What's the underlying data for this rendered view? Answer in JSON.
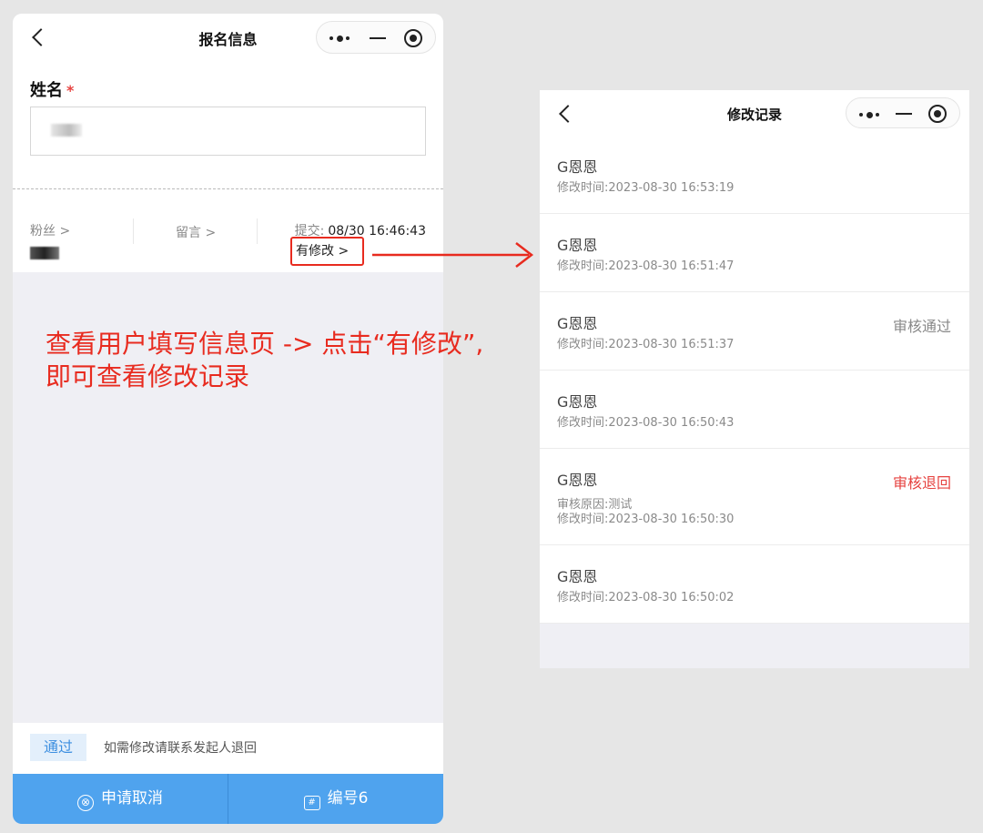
{
  "left": {
    "nav": {
      "title": "报名信息"
    },
    "form": {
      "name_label": "姓名",
      "required_mark": "*"
    },
    "stats": {
      "fans_label": "粉丝 >",
      "message_label": "留言 >",
      "submit_label": "提交:",
      "submit_time": "08/30 16:46:43",
      "modified_label": "有修改 >"
    },
    "bottom": {
      "badge": "通过",
      "hint": "如需修改请联系发起人退回"
    },
    "actions": {
      "cancel_icon": "⊗",
      "cancel_label": "申请取消",
      "number_icon": "#",
      "number_label": "编号6"
    }
  },
  "annotation": {
    "line1": "查看用户填写信息页 -> 点击“有修改”,",
    "line2": "即可查看修改记录",
    "color": "#e82b1f"
  },
  "right": {
    "nav": {
      "title": "修改记录"
    },
    "records": [
      {
        "name": "G恩恩",
        "time": "修改时间:2023-08-30 16:53:19",
        "status": "",
        "reason": ""
      },
      {
        "name": "G恩恩",
        "time": "修改时间:2023-08-30 16:51:47",
        "status": "",
        "reason": ""
      },
      {
        "name": "G恩恩",
        "time": "修改时间:2023-08-30 16:51:37",
        "status": "审核通过",
        "status_color": "#888888",
        "reason": ""
      },
      {
        "name": "G恩恩",
        "time": "修改时间:2023-08-30 16:50:43",
        "status": "",
        "reason": ""
      },
      {
        "name": "G恩恩",
        "time": "修改时间:2023-08-30 16:50:30",
        "status": "审核退回",
        "status_color": "#e64340",
        "reason": "审核原因:测试"
      },
      {
        "name": "G恩恩",
        "time": "修改时间:2023-08-30 16:50:02",
        "status": "",
        "reason": ""
      }
    ]
  },
  "colors": {
    "primary_blue": "#4fa3ee",
    "badge_bg": "#e3effb",
    "badge_text": "#3d8fe0",
    "highlight_red": "#e82b1f",
    "reject_red": "#e64340"
  }
}
